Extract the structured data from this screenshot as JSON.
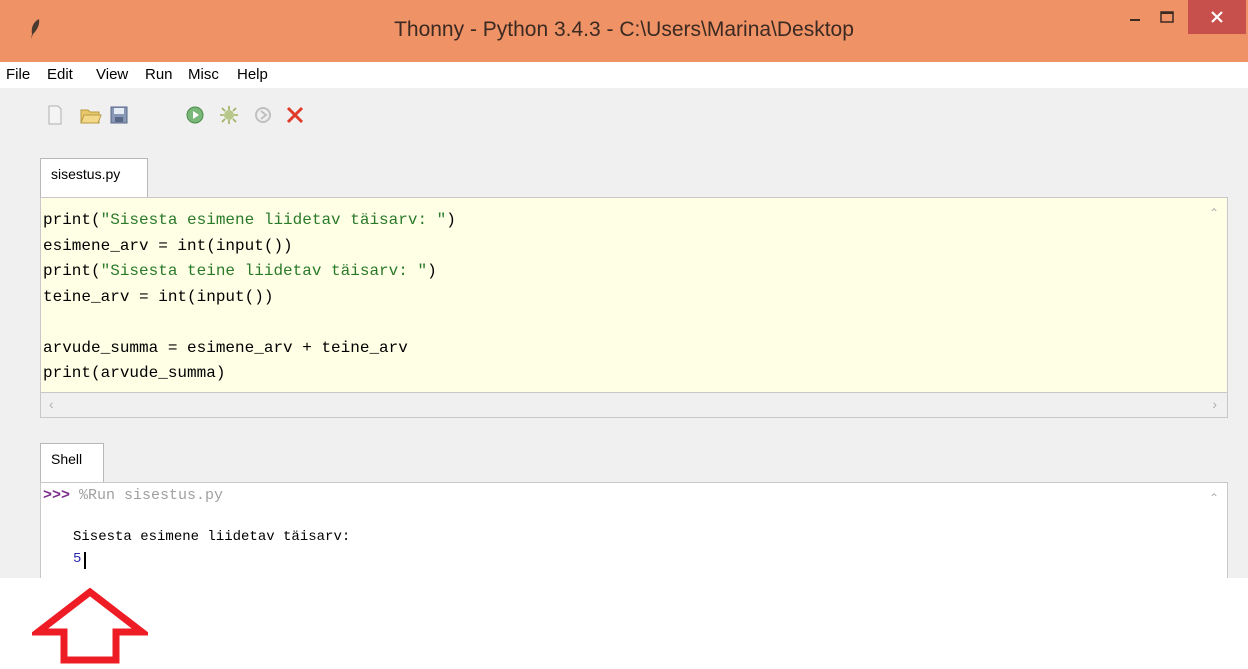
{
  "window": {
    "title": "Thonny  -  Python 3.4.3  -  C:\\Users\\Marina\\Desktop",
    "titlebar_color": "#ef9266",
    "close_color": "#c7504c"
  },
  "menu": {
    "items": [
      "File",
      "Edit",
      "View",
      "Run",
      "Misc",
      "Help"
    ]
  },
  "toolbar": {
    "icons": [
      "new-file-icon",
      "open-folder-icon",
      "save-icon",
      "run-icon",
      "debug-icon",
      "step-icon",
      "stop-icon"
    ]
  },
  "editor": {
    "tab_label": "sisestus.py",
    "background": "#ffffe6",
    "lines": [
      {
        "pre": "print(",
        "str": "\"Sisesta esimene liidetav täisarv: \"",
        "post": ")"
      },
      {
        "pre": "esimene_arv = int(input())",
        "str": "",
        "post": ""
      },
      {
        "pre": "print(",
        "str": "\"Sisesta teine liidetav täisarv: \"",
        "post": ")"
      },
      {
        "pre": "teine_arv = int(input())",
        "str": "",
        "post": ""
      },
      {
        "pre": "",
        "str": "",
        "post": ""
      },
      {
        "pre": "arvude_summa = esimene_arv + teine_arv",
        "str": "",
        "post": ""
      },
      {
        "pre": "print(arvude_summa)",
        "str": "",
        "post": ""
      }
    ]
  },
  "shell": {
    "tab_label": "Shell",
    "prompt": ">>>",
    "command": " %Run sisestus.py",
    "output": "Sisesta esimene liidetav täisarv:",
    "input_value": "5"
  },
  "annotation": {
    "arrow_color": "#ee1c25"
  }
}
